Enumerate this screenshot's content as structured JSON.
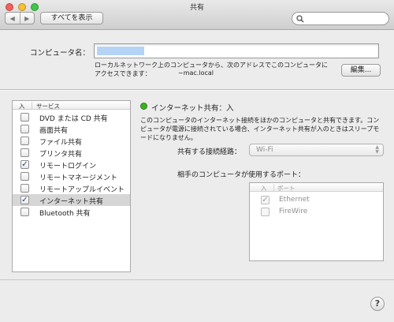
{
  "window": {
    "title": "共有"
  },
  "toolbar": {
    "back_icon": "◀",
    "forward_icon": "▶",
    "show_all_label": "すべてを表示",
    "search": {
      "placeholder": "",
      "value": ""
    }
  },
  "computer_name": {
    "label": "コンピュータ名：",
    "value": "",
    "description_line1": "ローカルネットワーク上のコンピュータから、次のアドレスでこのコンピュータに",
    "description_line2": "アクセスできます：",
    "hostname": "~mac.local",
    "edit_label": "編集..."
  },
  "services": {
    "header_on": "入",
    "header_name": "サービス",
    "items": [
      {
        "label": "DVD または CD 共有",
        "checked": false
      },
      {
        "label": "画面共有",
        "checked": false
      },
      {
        "label": "ファイル共有",
        "checked": false
      },
      {
        "label": "プリンタ共有",
        "checked": false
      },
      {
        "label": "リモートログイン",
        "checked": true
      },
      {
        "label": "リモートマネージメント",
        "checked": false
      },
      {
        "label": "リモートアップルイベント",
        "checked": false
      },
      {
        "label": "インターネット共有",
        "checked": true,
        "selected": true
      },
      {
        "label": "Bluetooth 共有",
        "checked": false
      }
    ]
  },
  "detail": {
    "status_title": "インターネット共有：入",
    "status_color": "#3bb321",
    "info_text": "このコンピュータのインターネット接続をほかのコンピュータと共有できます。コンピュータが電源に接続されている場合、インターネット共有が入のときはスリープモードになりません。",
    "share_from_label": "共有する接続経路：",
    "share_from_value": "Wi-Fi",
    "ports_label": "相手のコンピュータが使用するポート：",
    "ports_header_on": "入",
    "ports_header_name": "ポート",
    "ports": [
      {
        "label": "Ethernet",
        "checked": true
      },
      {
        "label": "FireWire",
        "checked": false
      }
    ]
  },
  "help_label": "?",
  "check_mark": "✓"
}
